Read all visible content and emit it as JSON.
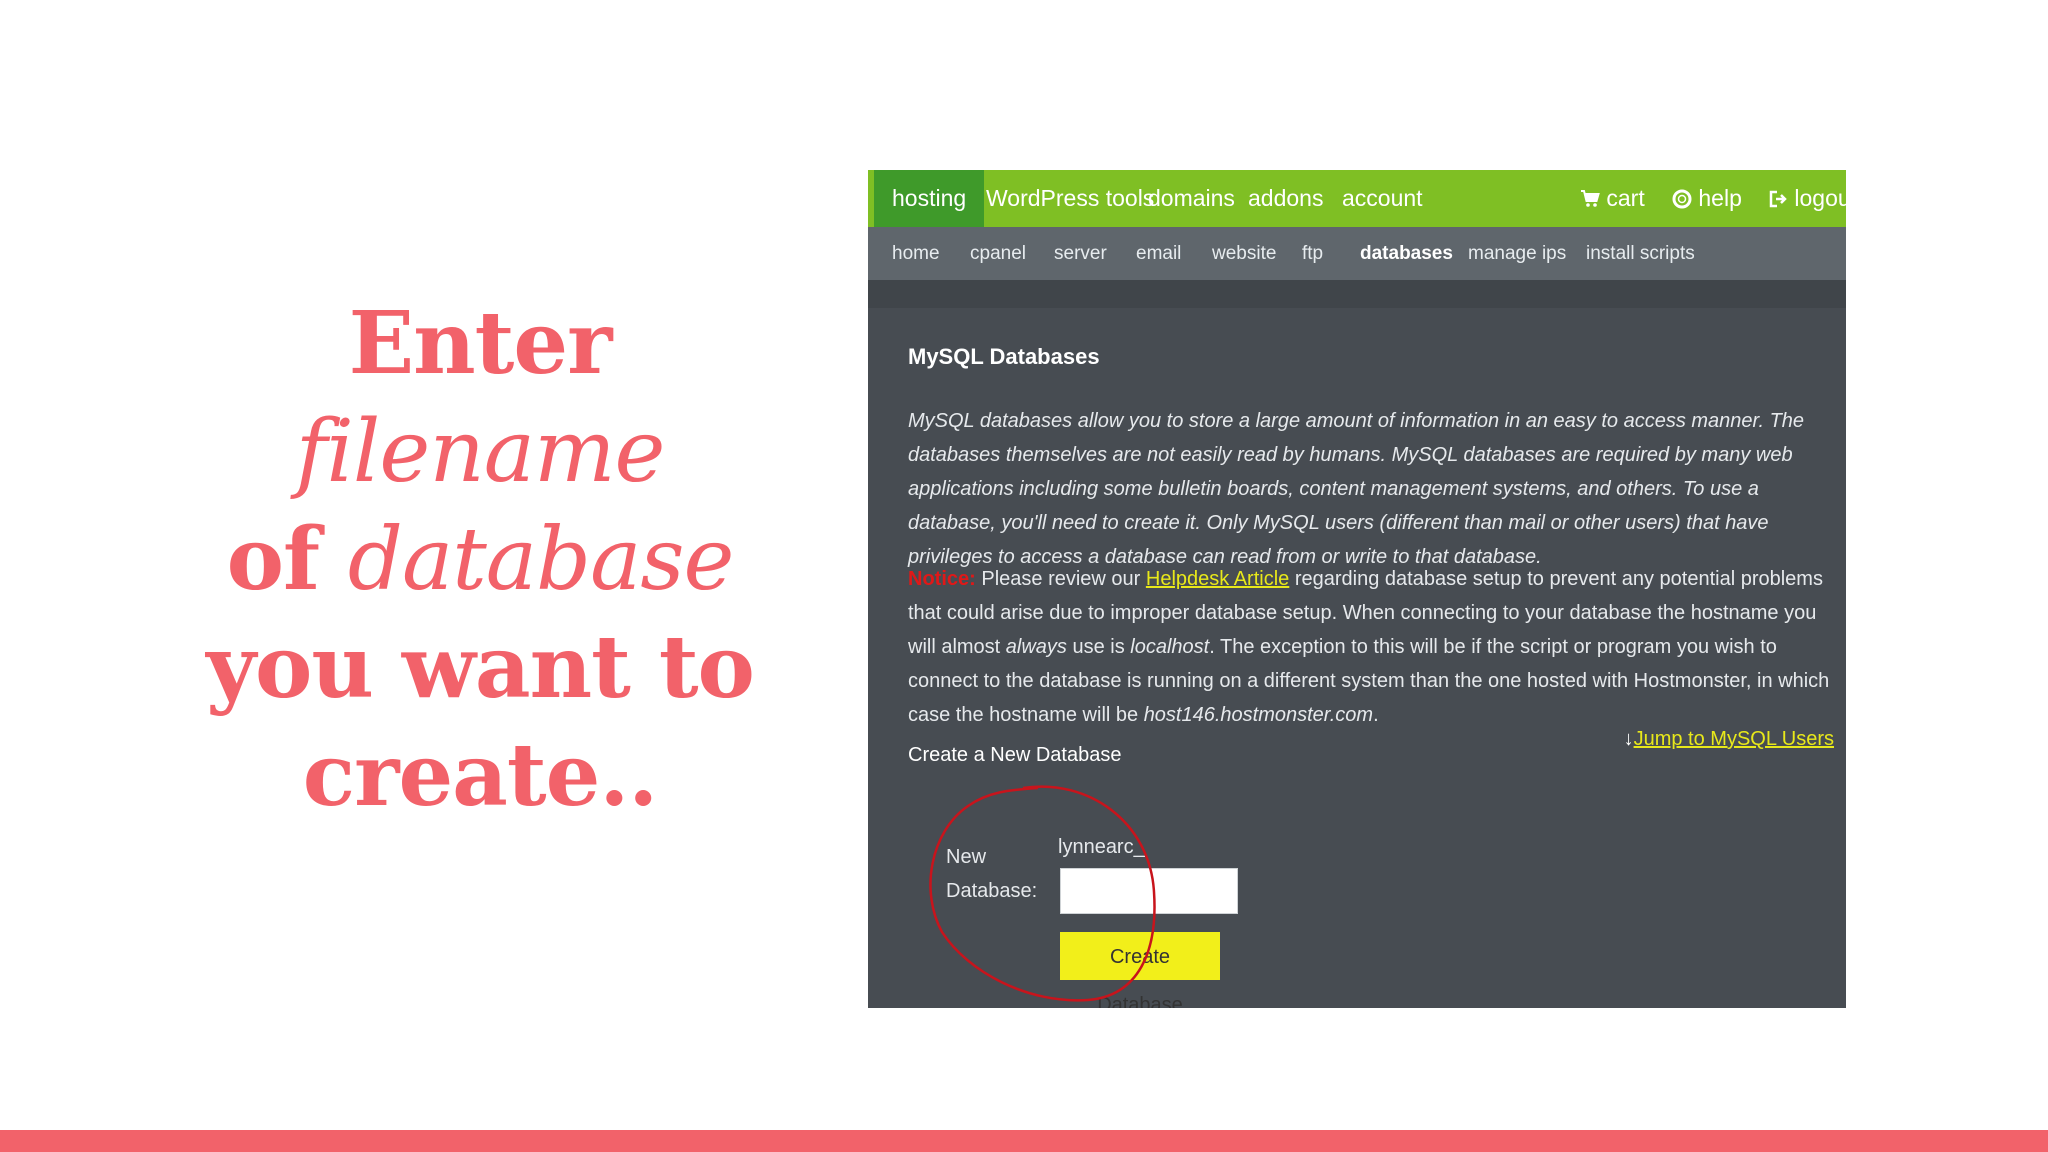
{
  "slide": {
    "line1": "Enter",
    "line2": "filename",
    "line3_a": "of",
    "line3_b": "database",
    "line4": "you want to",
    "line5": "create.."
  },
  "topnav": {
    "hosting": "hosting",
    "wordpress": "WordPress tools",
    "domains": "domains",
    "addons": "addons",
    "account": "account",
    "cart": "cart",
    "help": "help",
    "logout": "logout"
  },
  "subnav": {
    "home": "home",
    "cpanel": "cpanel",
    "server": "server",
    "email": "email",
    "website": "website",
    "ftp": "ftp",
    "databases": "databases",
    "manage_ips": "manage ips",
    "install_scripts": "install scripts"
  },
  "content": {
    "title": "MySQL Databases",
    "description": "MySQL databases allow you to store a large amount of information in an easy to access manner. The databases themselves are not easily read by humans. MySQL databases are required by many web applications including some bulletin boards, content management systems, and others. To use a database, you'll need to create it. Only MySQL users (different than mail or other users) that have privileges to access a database can read from or write to that database.",
    "notice_label": "Notice:",
    "notice_pre": " Please review our ",
    "notice_link": "Helpdesk Article",
    "notice_mid": " regarding database setup to prevent any potential problems that could arise due to improper database setup. When connecting to your database the hostname you will almost ",
    "notice_always": "always",
    "notice_mid2": " use is ",
    "notice_localhost": "localhost",
    "notice_mid3": ". The exception to this will be if the script or program you wish to connect to the database is running on a different system than the one hosted with Hostmonster, in which case the hostname will be ",
    "notice_host": "host146.hostmonster.com",
    "notice_end": ".",
    "create_heading": "Create a New Database",
    "jump_arrow": "↓",
    "jump_link": "Jump to MySQL Users",
    "new_label_1": "New",
    "new_label_2": "Database:",
    "prefix": "lynnearc_",
    "input_value": "",
    "button": "Create Database"
  },
  "colors": {
    "accent": "#f2626a",
    "nav_green": "#7fbf24",
    "nav_active": "#3f9a2a",
    "panel_bg": "#474c52",
    "link_yellow": "#e8e81a",
    "button_yellow": "#f2ef1a",
    "notice_red": "#e01818",
    "ring_red": "#c8141c"
  },
  "icons": {
    "cart": "cart-icon",
    "help": "lifebuoy-icon",
    "logout": "logout-icon"
  }
}
